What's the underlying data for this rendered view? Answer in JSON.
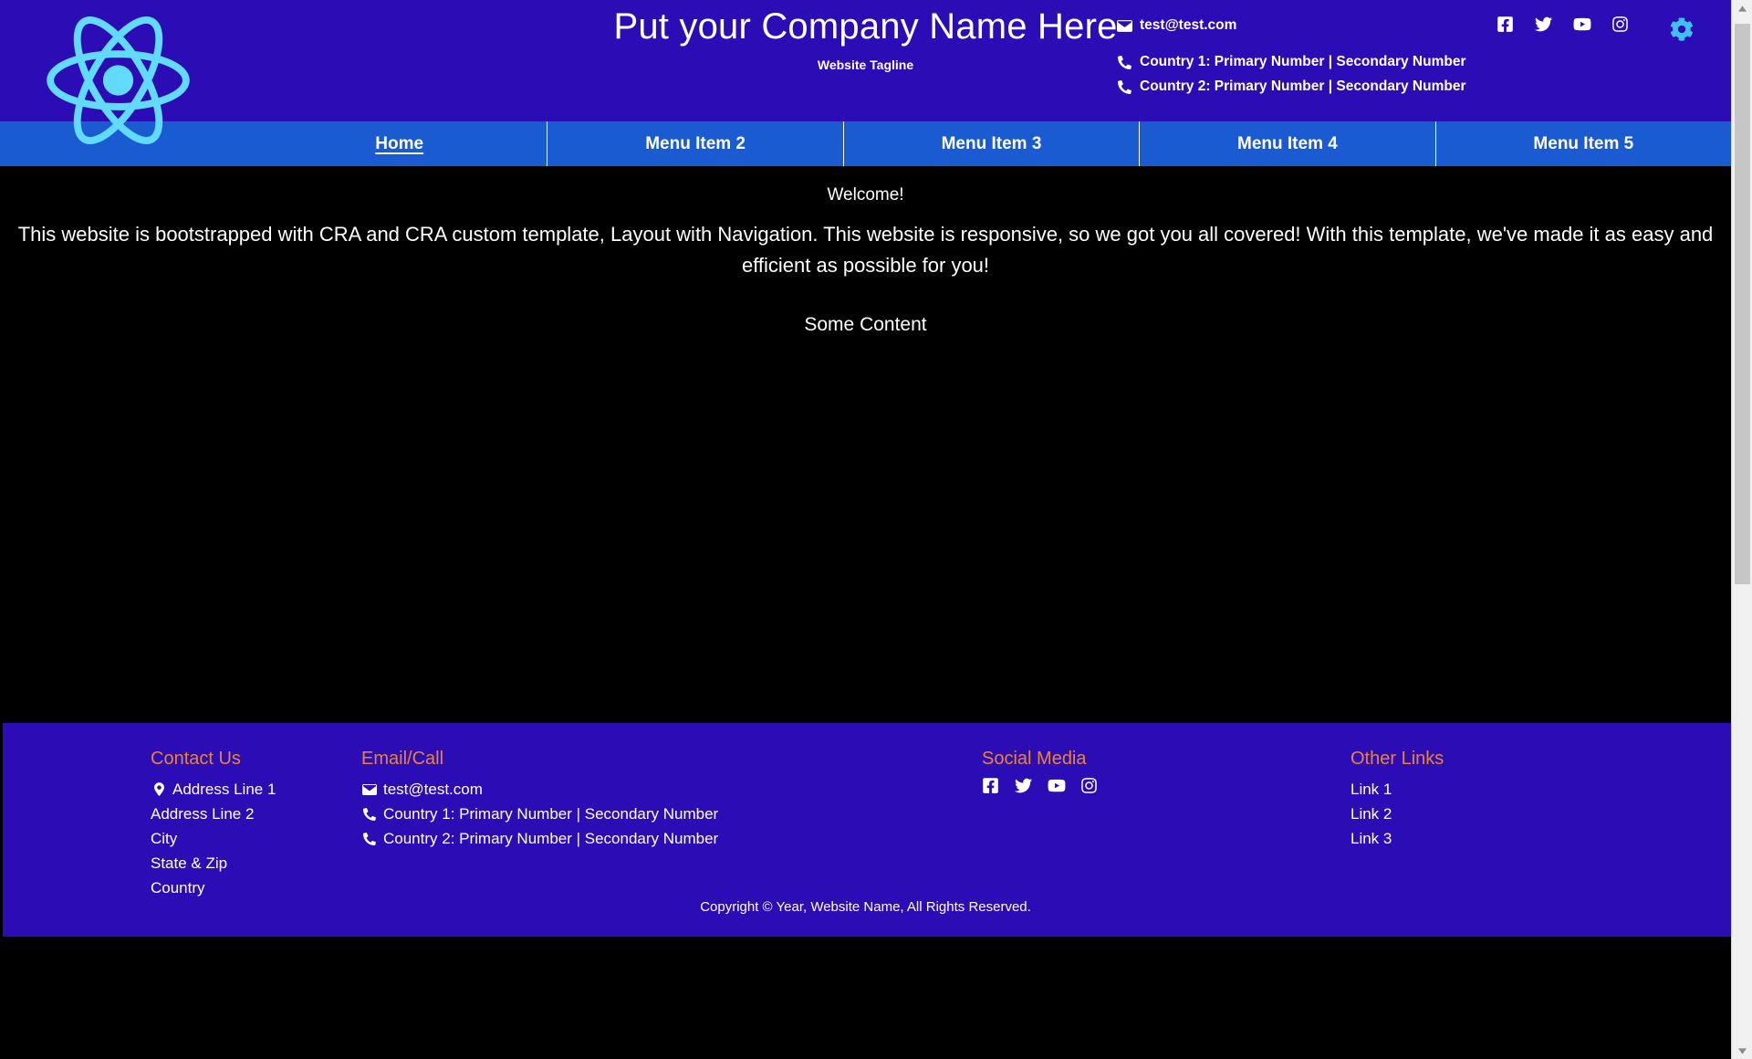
{
  "header": {
    "logo_icon": "react-logo-icon",
    "company_name": "Put your Company Name Here",
    "tagline": "Website Tagline",
    "email": "test@test.com",
    "phone_1": "Country 1: Primary Number | Secondary Number",
    "phone_2": "Country 2: Primary Number | Secondary Number",
    "social": [
      {
        "name": "facebook-icon",
        "label": "Facebook"
      },
      {
        "name": "twitter-icon",
        "label": "Twitter"
      },
      {
        "name": "youtube-icon",
        "label": "YouTube"
      },
      {
        "name": "instagram-icon",
        "label": "Instagram"
      }
    ],
    "settings_icon": "gear-icon",
    "bg_color": "#2c0cb4"
  },
  "nav": {
    "bg_color": "#1a5bd2",
    "items": [
      {
        "label": "Home",
        "active": true
      },
      {
        "label": "Menu Item 2",
        "active": false
      },
      {
        "label": "Menu Item 3",
        "active": false
      },
      {
        "label": "Menu Item 4",
        "active": false
      },
      {
        "label": "Menu Item 5",
        "active": false
      }
    ]
  },
  "main": {
    "bg_color": "#000000",
    "welcome_title": "Welcome!",
    "paragraph": "This website is bootstrapped with CRA and CRA custom template, Layout with Navigation. This website is responsive, so we got you all covered! With this template, we've made it as easy and efficient as possible for you!",
    "some_content": "Some Content"
  },
  "footer": {
    "bg_color": "#2c0cb4",
    "heading_color": "#e8833a",
    "contact": {
      "heading": "Contact Us",
      "address_line_1": "Address Line 1",
      "address_line_2": "Address Line 2",
      "city": "City",
      "state_zip": "State & Zip",
      "country": "Country"
    },
    "email_call": {
      "heading": "Email/Call",
      "email": "test@test.com",
      "phone_1": "Country 1: Primary Number | Secondary Number",
      "phone_2": "Country 2: Primary Number | Secondary Number"
    },
    "social_media": {
      "heading": "Social Media",
      "icons": [
        {
          "name": "facebook-icon",
          "label": "Facebook"
        },
        {
          "name": "twitter-icon",
          "label": "Twitter"
        },
        {
          "name": "youtube-icon",
          "label": "YouTube"
        },
        {
          "name": "instagram-icon",
          "label": "Instagram"
        }
      ]
    },
    "other_links": {
      "heading": "Other Links",
      "links": [
        {
          "label": "Link 1"
        },
        {
          "label": "Link 2"
        },
        {
          "label": "Link 3"
        }
      ]
    },
    "copyright": "Copyright © Year,  Website Name, All Rights Reserved."
  },
  "browser": {
    "scrollbar_up_icon": "scroll-up-arrow-icon",
    "scrollbar_down_icon": "scroll-down-arrow-icon"
  }
}
